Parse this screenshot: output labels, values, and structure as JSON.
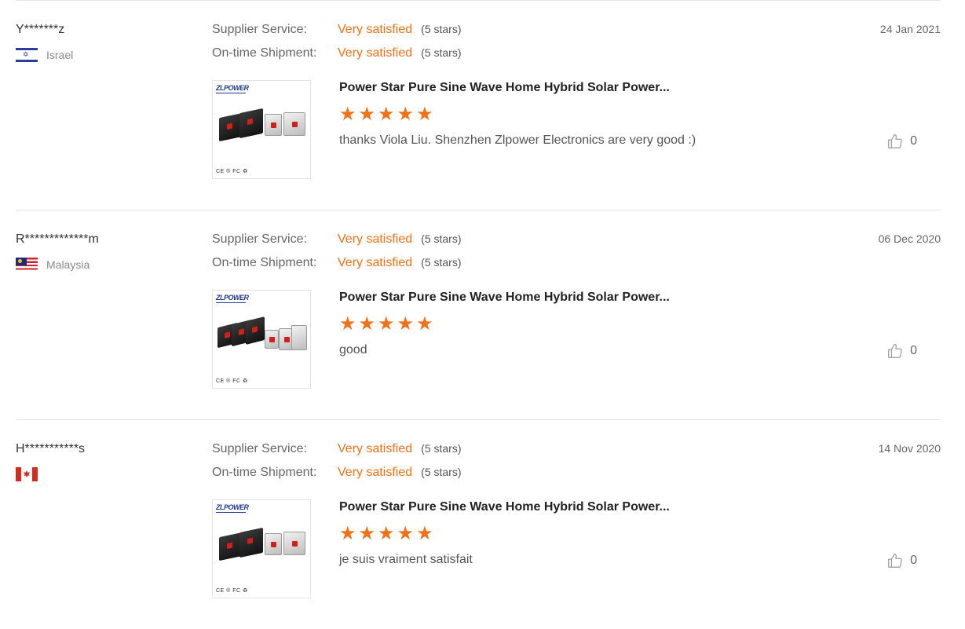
{
  "labels": {
    "supplier_service": "Supplier Service:",
    "ontime_shipment": "On-time Shipment:"
  },
  "accent_color": "#f07117",
  "reviews": [
    {
      "user": "Y*******z",
      "country": "Israel",
      "country_flag": "israel-flag",
      "supplier_service": "Very satisfied",
      "supplier_service_stars": "(5 stars)",
      "ontime_shipment": "Very satisfied",
      "ontime_shipment_stars": "(5 stars)",
      "date": "24 Jan 2021",
      "product_title": "Power Star Pure Sine Wave Home Hybrid Solar Power...",
      "product_brand": "ZLPOWER",
      "product_certs": "CE ® FC ♻",
      "product_rating": 5,
      "comment": "thanks Viola Liu. Shenzhen Zlpower Electronics are very good :)",
      "likes": "0"
    },
    {
      "user": "R*************m",
      "country": "Malaysia",
      "country_flag": "malaysia-flag",
      "supplier_service": "Very satisfied",
      "supplier_service_stars": "(5 stars)",
      "ontime_shipment": "Very satisfied",
      "ontime_shipment_stars": "(5 stars)",
      "date": "06 Dec 2020",
      "product_title": "Power Star Pure Sine Wave Home Hybrid Solar Power...",
      "product_brand": "ZLPOWER",
      "product_certs": "CE ® FC ♻",
      "product_rating": 5,
      "comment": "good",
      "likes": "0"
    },
    {
      "user": "H***********s",
      "country": "",
      "country_flag": "canada-flag",
      "supplier_service": "Very satisfied",
      "supplier_service_stars": "(5 stars)",
      "ontime_shipment": "Very satisfied",
      "ontime_shipment_stars": "(5 stars)",
      "date": "14 Nov 2020",
      "product_title": "Power Star Pure Sine Wave Home Hybrid Solar Power...",
      "product_brand": "ZLPOWER",
      "product_certs": "CE ® FC ♻",
      "product_rating": 5,
      "comment": "je suis vraiment satisfait",
      "likes": "0"
    }
  ]
}
